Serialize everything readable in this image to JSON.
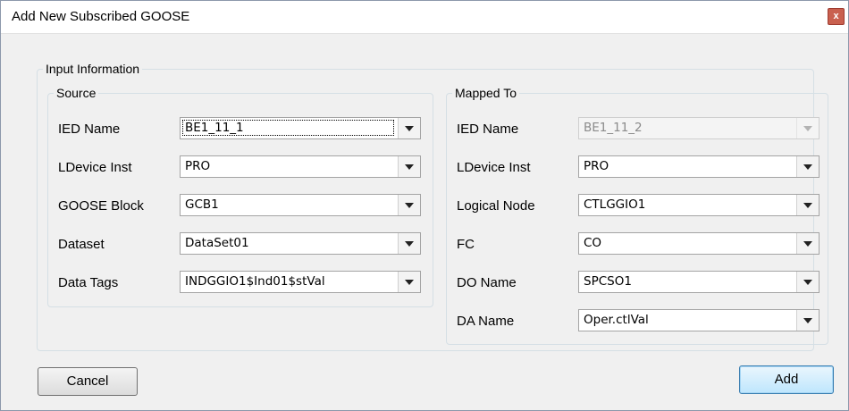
{
  "window": {
    "title": "Add New Subscribed GOOSE",
    "close_label": "x"
  },
  "input_group": {
    "legend": "Input Information"
  },
  "source": {
    "legend": "Source",
    "fields": [
      {
        "label": "IED Name",
        "value": "BE1_11_1"
      },
      {
        "label": "LDevice Inst",
        "value": "PRO"
      },
      {
        "label": "GOOSE Block",
        "value": "GCB1"
      },
      {
        "label": "Dataset",
        "value": "DataSet01"
      },
      {
        "label": "Data Tags",
        "value": "INDGGIO1$Ind01$stVal"
      }
    ]
  },
  "mapped": {
    "legend": "Mapped To",
    "fields": [
      {
        "label": "IED Name",
        "value": "BE1_11_2"
      },
      {
        "label": "LDevice Inst",
        "value": "PRO"
      },
      {
        "label": "Logical Node",
        "value": "CTLGGIO1"
      },
      {
        "label": "FC",
        "value": "CO"
      },
      {
        "label": "DO Name",
        "value": "SPCSO1"
      },
      {
        "label": "DA Name",
        "value": "Oper.ctlVal"
      }
    ]
  },
  "buttons": {
    "cancel": "Cancel",
    "add": "Add"
  }
}
